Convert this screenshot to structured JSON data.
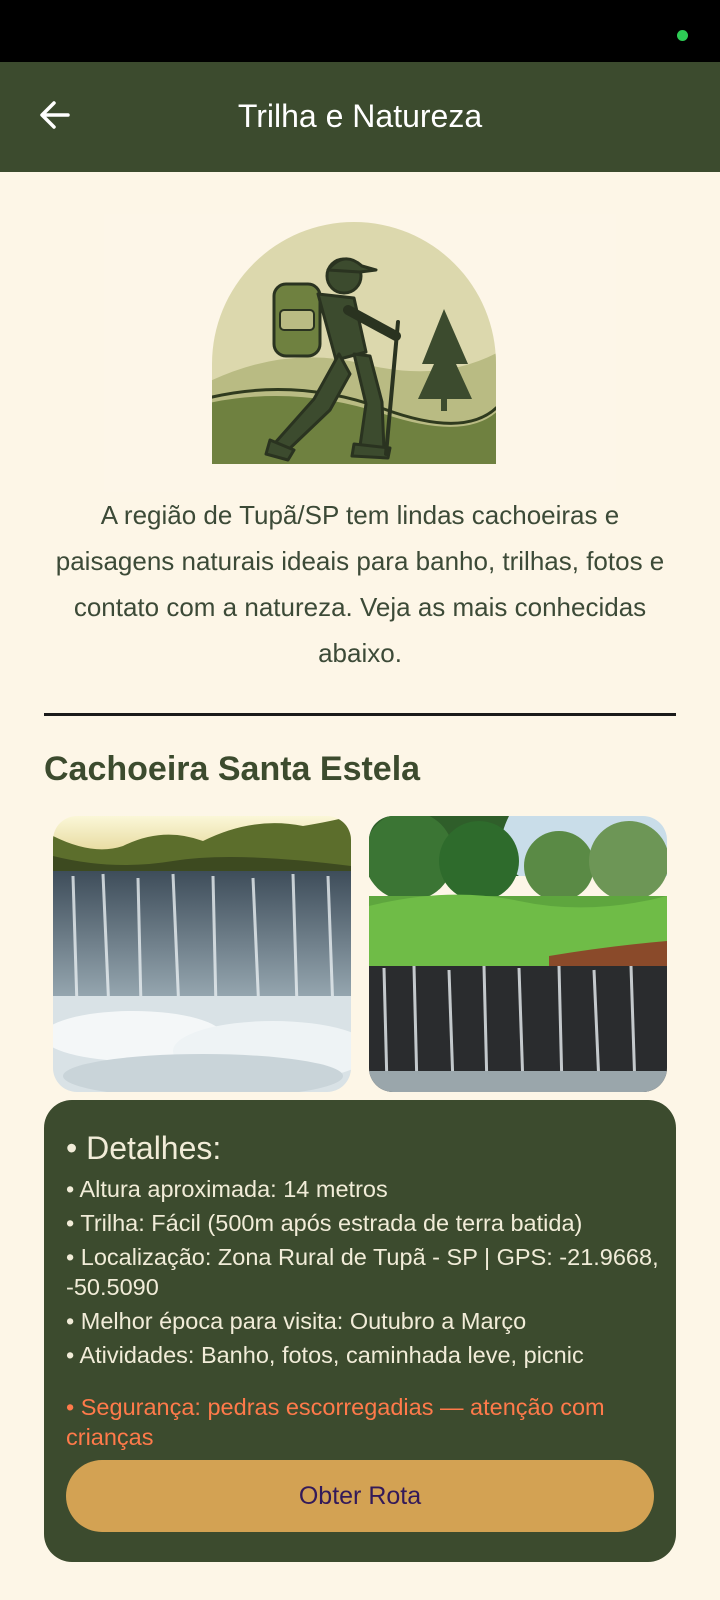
{
  "header": {
    "title": "Trilha e Natureza"
  },
  "intro": "A região de Tupã/SP tem lindas cachoeiras e paisagens naturais ideais para banho, trilhas, fotos e contato com a natureza. Veja as mais conhecidas abaixo.",
  "section": {
    "title": "Cachoeira Santa Estela"
  },
  "details": {
    "heading": "• Detalhes:",
    "lines": [
      "• Altura aproximada: 14 metros",
      "• Trilha: Fácil (500m após estrada de terra batida)",
      "• Localização: Zona Rural de Tupã - SP | GPS: -21.9668, -50.5090",
      "• Melhor época para visita: Outubro a Março",
      "• Atividades: Banho, fotos, caminhada leve, picnic"
    ],
    "warning": "• Segurança: pedras escorregadias — atenção com crianças",
    "button": "Obter Rota"
  },
  "colors": {
    "app_bar": "#3c4b2e",
    "background": "#fdf6e7",
    "accent_button": "#d3a253",
    "warning": "#ff7a4a"
  },
  "icons": {
    "back": "arrow-left-icon",
    "hero": "hiker-illustration"
  }
}
